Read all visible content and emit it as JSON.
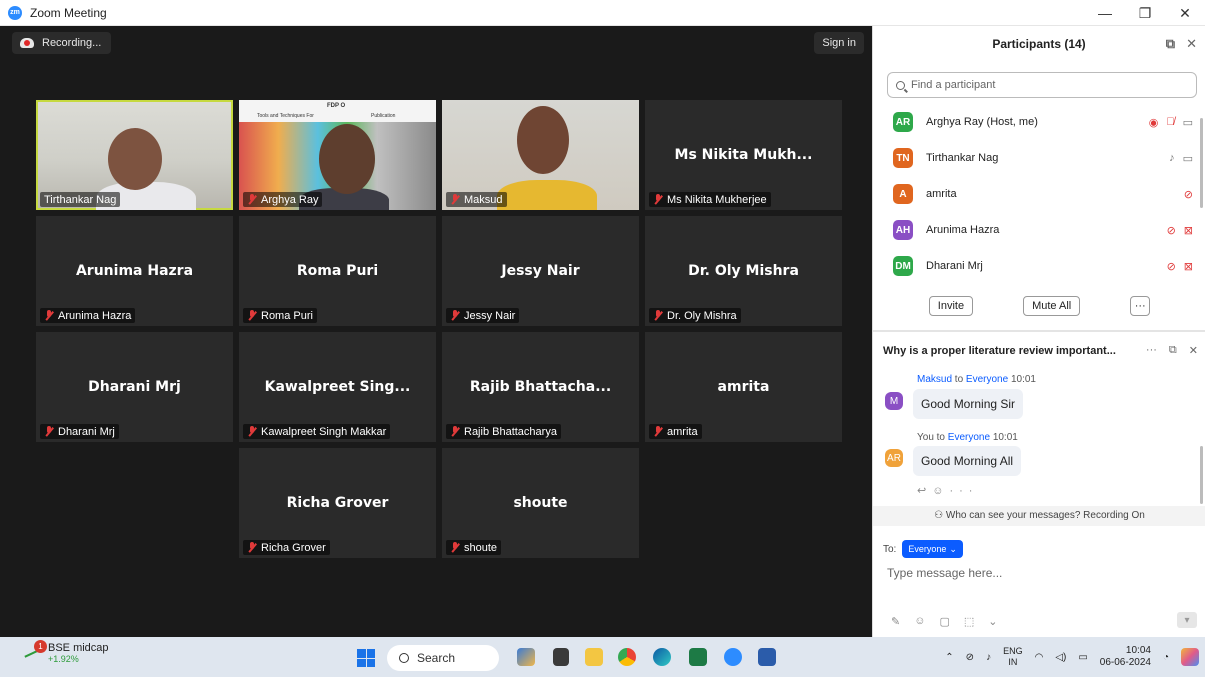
{
  "window": {
    "title": "Zoom Meeting",
    "minimize": "—",
    "restore": "❐",
    "close": "✕"
  },
  "meeting": {
    "recording_label": "Recording...",
    "signin_label": "Sign in",
    "tiles": [
      {
        "center": "",
        "label": "Tirthankar Nag",
        "muted": false
      },
      {
        "center": "",
        "label": "Arghya Ray",
        "muted": true
      },
      {
        "center": "",
        "label": "Maksud",
        "muted": true
      },
      {
        "center": "Ms Nikita Mukh...",
        "label": "Ms Nikita Mukherjee",
        "muted": true
      },
      {
        "center": "Arunima Hazra",
        "label": "Arunima Hazra",
        "muted": true
      },
      {
        "center": "Roma Puri",
        "label": "Roma Puri",
        "muted": true
      },
      {
        "center": "Jessy Nair",
        "label": "Jessy Nair",
        "muted": true
      },
      {
        "center": "Dr. Oly Mishra",
        "label": "Dr. Oly Mishra",
        "muted": true
      },
      {
        "center": "Dharani Mrj",
        "label": "Dharani Mrj",
        "muted": true
      },
      {
        "center": "Kawalpreet  Sing...",
        "label": "Kawalpreet Singh Makkar",
        "muted": true
      },
      {
        "center": "Rajib  Bhattacha...",
        "label": "Rajib Bhattacharya",
        "muted": true
      },
      {
        "center": "amrita",
        "label": "amrita",
        "muted": true
      },
      {
        "center": "Richa Grover",
        "label": "Richa Grover",
        "muted": true
      },
      {
        "center": "shoute",
        "label": "shoute",
        "muted": true
      }
    ],
    "slide_title": "FDP O",
    "slide_subtitle": "Tools and Techniques For",
    "slide_subtitle2": "Publication"
  },
  "participants": {
    "title": "Participants (14)",
    "search_placeholder": "Find a participant",
    "list": [
      {
        "initials": "AR",
        "name": "Arghya Ray (Host, me)",
        "color": "#2ea84a"
      },
      {
        "initials": "TN",
        "name": "Tirthankar Nag",
        "color": "#e0661f"
      },
      {
        "initials": "A",
        "name": "amrita",
        "color": "#e0661f"
      },
      {
        "initials": "AH",
        "name": "Arunima Hazra",
        "color": "#8a4fc4"
      },
      {
        "initials": "DM",
        "name": "Dharani Mrj",
        "color": "#2ea84a"
      }
    ],
    "invite_label": "Invite",
    "mute_all_label": "Mute All",
    "more_label": "···"
  },
  "chat": {
    "title": "Why is a proper literature review important...",
    "messages": [
      {
        "sender": "Maksud",
        "to_word": "to",
        "recipient": "Everyone",
        "time": "10:01",
        "text": "Good Morning Sir",
        "avatar": "M",
        "avatar_color": "#8a4fc4"
      },
      {
        "sender": "You",
        "to_word": "to",
        "recipient": "Everyone",
        "time": "10:01",
        "text": "Good Morning All",
        "avatar": "AR",
        "avatar_color": "#f0a23a"
      }
    ],
    "visibility_note": "Who can see your messages? Recording On",
    "to_label": "To:",
    "to_value": "Everyone",
    "input_placeholder": "Type message here..."
  },
  "taskbar": {
    "stock_name": "BSE midcap",
    "stock_change": "+1.92%",
    "stock_badge": "1",
    "search_label": "Search",
    "lang_top": "ENG",
    "lang_bottom": "IN",
    "time": "10:04",
    "date": "06-06-2024"
  }
}
